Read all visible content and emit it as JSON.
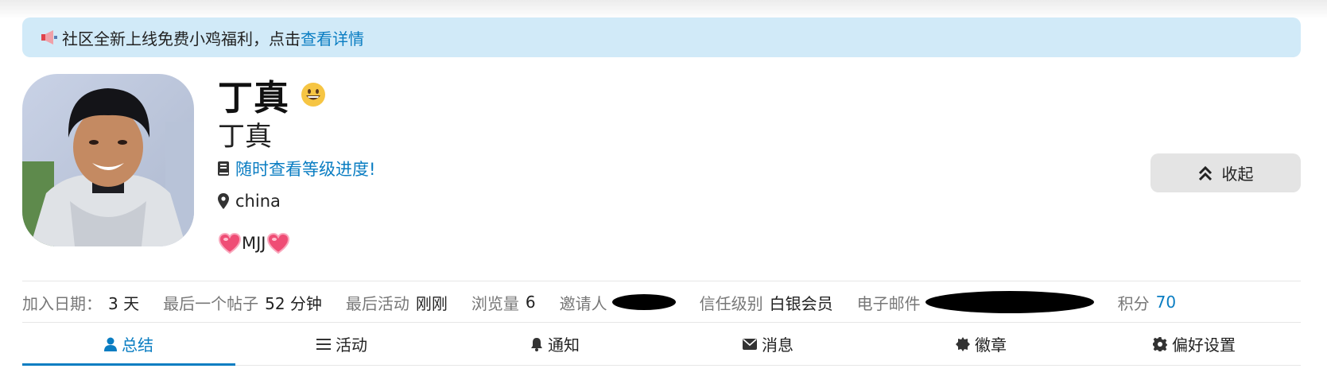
{
  "banner": {
    "icon": "megaphone-icon",
    "text": "社区全新上线免费小鸡福利，点击",
    "link": "查看详情"
  },
  "profile": {
    "avatar": "user-avatar-photo",
    "name": "丁真",
    "status_emoji": "grinning-face-icon",
    "subname": "丁真",
    "progress_link": "随时查看等级进度!",
    "location": "china",
    "bio": "MJJ"
  },
  "collapse_button": {
    "label": "收起",
    "icon": "double-chevron-up-icon"
  },
  "stats": [
    {
      "label": "加入日期：",
      "value": "3 天"
    },
    {
      "label": "最后一个帖子",
      "value": "52 分钟"
    },
    {
      "label": "最后活动",
      "value": "刚刚"
    },
    {
      "label": "浏览量",
      "value": "6"
    },
    {
      "label": "邀请人",
      "value": ""
    },
    {
      "label": "信任级别",
      "value": "白银会员"
    },
    {
      "label": "电子邮件",
      "value": ""
    },
    {
      "label": "积分",
      "value": "70"
    }
  ],
  "tabs": [
    {
      "label": "总结",
      "icon": "user-icon",
      "active": true
    },
    {
      "label": "活动",
      "icon": "list-icon",
      "active": false
    },
    {
      "label": "通知",
      "icon": "bell-icon",
      "active": false
    },
    {
      "label": "消息",
      "icon": "envelope-icon",
      "active": false
    },
    {
      "label": "徽章",
      "icon": "badge-icon",
      "active": false
    },
    {
      "label": "偏好设置",
      "icon": "gear-icon",
      "active": false
    }
  ],
  "colors": {
    "accent": "#0a7dc2",
    "banner_bg": "#d1eaf8",
    "button_bg": "#e4e4e4",
    "muted_text": "#777777"
  }
}
